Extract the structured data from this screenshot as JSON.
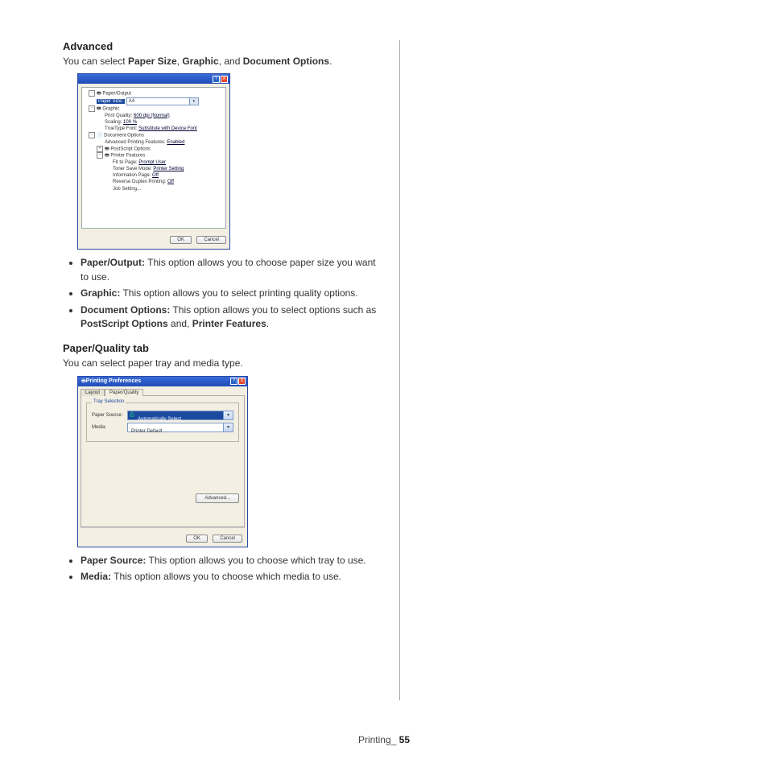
{
  "section1": {
    "heading": "Advanced",
    "intro_pre": "You can select ",
    "intro_b1": "Paper Size",
    "intro_mid1": ", ",
    "intro_b2": "Graphic",
    "intro_mid2": ", and ",
    "intro_b3": "Document Options",
    "intro_post": "."
  },
  "advDialog": {
    "help": "?",
    "close": "X",
    "tree": {
      "paperOutput": "Paper/Output",
      "paperSizeLbl": "Paper Size:",
      "paperSizeVal": "A4",
      "graphic": "Graphic",
      "printQualityLbl": "Print Quality:",
      "printQualityVal": "600 dpi (Normal)",
      "scalingLbl": "Scaling:",
      "scalingVal": "100 %",
      "ttfLbl": "TrueType Font:",
      "ttfVal": "Substitute with Device Font",
      "docOptions": "Document Options",
      "advPrintLbl": "Advanced Printing Features:",
      "advPrintVal": "Enabled",
      "psOptions": "PostScript Options",
      "printerFeatures": "Printer Features",
      "fitLbl": "Fit to Page:",
      "fitVal": "Prompt User",
      "tonerLbl": "Toner Save Mode:",
      "tonerVal": "Printer Setting",
      "infoLbl": "Information Page:",
      "infoVal": "Off",
      "revLbl": "Reverse Duplex Printing:",
      "revVal": "Off",
      "jobSetting": "Job Setting..."
    },
    "ok": "OK",
    "cancel": "Cancel"
  },
  "bullets1": {
    "b1_strong": "Paper/Output:",
    "b1_text": "  This option allows you to choose paper size you want to use.",
    "b2_strong": "Graphic:",
    "b2_text": "  This option allows you to select printing quality options.",
    "b3_strong": "Document Options:",
    "b3_text_a": "  This option allows you to select options such as ",
    "b3_strong2": "PostScript Options",
    "b3_text_b": " and, ",
    "b3_strong3": "Printer Features",
    "b3_text_c": "."
  },
  "section2": {
    "heading": "Paper/Quality tab",
    "intro": "You can select paper tray and media type."
  },
  "pqDialog": {
    "title": "Printing Preferences",
    "help": "?",
    "close": "X",
    "tabLayout": "Layout",
    "tabPQ": "Paper/Quality",
    "group": "Tray Selection",
    "paperSourceLbl": "Paper Source:",
    "paperSourceVal": "Automatically Select",
    "mediaLbl": "Media:",
    "mediaVal": "Printer Default",
    "advanced": "Advanced...",
    "ok": "OK",
    "cancel": "Cancel"
  },
  "bullets2": {
    "b1_strong": "Paper Source:",
    "b1_text": "  This option allows you to choose which tray to use.",
    "b2_strong": "Media:",
    "b2_text": "  This option allows you to choose which media to use."
  },
  "footer": {
    "pre": "Printing",
    "sep": "_ ",
    "page": "55"
  }
}
